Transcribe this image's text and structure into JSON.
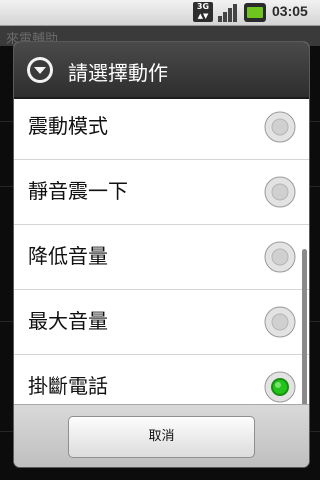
{
  "status_bar": {
    "network": "3G",
    "time": "03:05",
    "icons": [
      "3g-icon",
      "signal-icon",
      "battery-icon"
    ]
  },
  "background_app": {
    "title": "來電輔助"
  },
  "dialog": {
    "title": "請選擇動作",
    "options": [
      {
        "label": "震動模式",
        "selected": false
      },
      {
        "label": "靜音震一下",
        "selected": false
      },
      {
        "label": "降低音量",
        "selected": false
      },
      {
        "label": "最大音量",
        "selected": false
      },
      {
        "label": "掛斷電話",
        "selected": true
      }
    ],
    "cancel_label": "取消"
  },
  "colors": {
    "radio_selected": "#22c31a",
    "header_bg": "#3a3a3a",
    "footer_bg": "#cfcfcf"
  }
}
